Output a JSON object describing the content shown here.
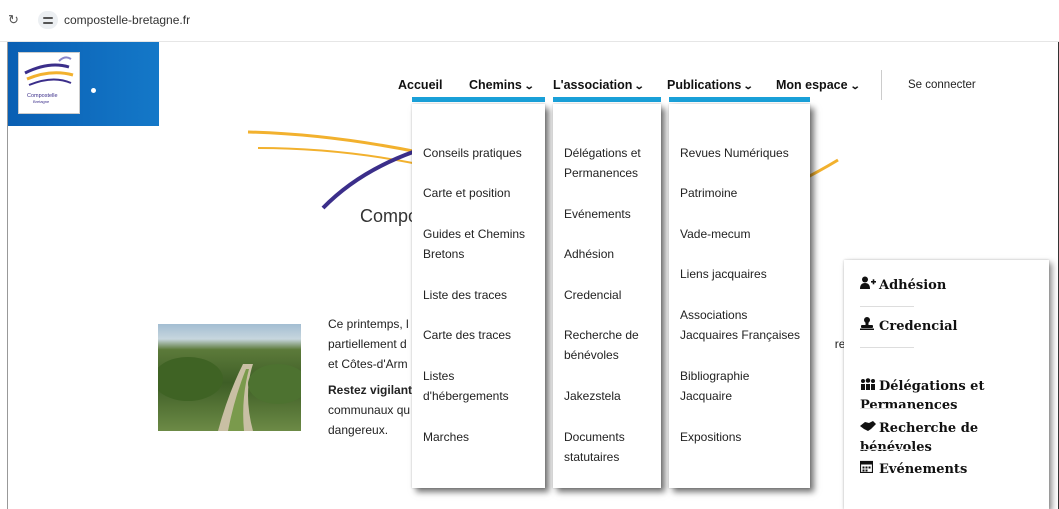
{
  "browser": {
    "url": "compostelle-bretagne.fr"
  },
  "logo": {
    "text_line1": "Compostelle",
    "text_line2": "Bretagne"
  },
  "nav": {
    "accueil": "Accueil",
    "chemins": "Chemins",
    "association": "L'association",
    "publications": "Publications",
    "mon_espace": "Mon espace",
    "login": "Se connecter"
  },
  "hero": {
    "title": "Compo"
  },
  "dropdowns": {
    "chemins": [
      "Conseils pratiques",
      "Carte et position",
      "Guides et Chemins\nBretons",
      "Liste des traces",
      "Carte des traces",
      "Listes\nd'hébergements",
      "Marches"
    ],
    "association": [
      "Délégations et\nPermanences",
      "Evénements",
      "Adhésion",
      "Credencial",
      "Recherche de\nbénévoles",
      "Jakezstela",
      "Documents\nstatutaires"
    ],
    "publications": [
      "Revues Numériques",
      "Patrimoine",
      "Vade-mecum",
      "Liens jacquaires",
      "Associations\nJacquaires Françaises",
      "Bibliographie\nJacquaire",
      "Expositions"
    ]
  },
  "article": {
    "line1a": "Ce printemps, l",
    "line1b": "",
    "line2a": "partiellement d",
    "line2b": "re",
    "line3": "et Côtes-d'Arm",
    "line4_bold": "Restez vigilant",
    "line5": "communaux qu",
    "line6": "dangereux."
  },
  "widget": {
    "items": [
      {
        "label": "Adhésion",
        "icon": "user-plus-icon"
      },
      {
        "label": "Credencial",
        "icon": "stamp-icon"
      },
      {
        "label": "Délégations et\nPermanences",
        "icon": "people-group-icon"
      },
      {
        "label": "Recherche de bénévoles",
        "icon": "handshake-icon"
      },
      {
        "label": "Evénements",
        "icon": "calendar-icon"
      }
    ]
  },
  "colors": {
    "brand_blue": "#0a5fb3",
    "nav_underline": "#1aa0d8"
  }
}
